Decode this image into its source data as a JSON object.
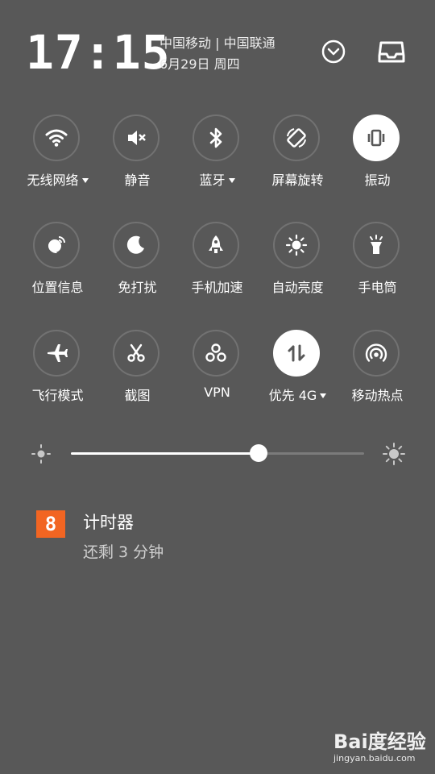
{
  "header": {
    "time": "17:15",
    "carrier": "中国移动 | 中国联通",
    "date": "6月29日 周四",
    "expand_icon": "chevron-down-circle-icon",
    "tray_icon": "notification-tray-icon"
  },
  "quick_settings": [
    {
      "label": "无线网络",
      "icon": "wifi-icon",
      "active": false,
      "dropdown": true
    },
    {
      "label": "静音",
      "icon": "mute-icon",
      "active": false,
      "dropdown": false
    },
    {
      "label": "蓝牙",
      "icon": "bluetooth-icon",
      "active": false,
      "dropdown": true
    },
    {
      "label": "屏幕旋转",
      "icon": "screen-rotate-icon",
      "active": false,
      "dropdown": false
    },
    {
      "label": "振动",
      "icon": "vibrate-icon",
      "active": true,
      "dropdown": false
    },
    {
      "label": "位置信息",
      "icon": "location-icon",
      "active": false,
      "dropdown": false
    },
    {
      "label": "免打扰",
      "icon": "moon-icon",
      "active": false,
      "dropdown": false
    },
    {
      "label": "手机加速",
      "icon": "rocket-icon",
      "active": false,
      "dropdown": false
    },
    {
      "label": "自动亮度",
      "icon": "auto-brightness-icon",
      "active": false,
      "dropdown": false
    },
    {
      "label": "手电筒",
      "icon": "flashlight-icon",
      "active": false,
      "dropdown": false
    },
    {
      "label": "飞行模式",
      "icon": "airplane-icon",
      "active": false,
      "dropdown": false
    },
    {
      "label": "截图",
      "icon": "scissors-icon",
      "active": false,
      "dropdown": false
    },
    {
      "label": "VPN",
      "icon": "vpn-icon",
      "active": false,
      "dropdown": false
    },
    {
      "label": "优先 4G",
      "icon": "data-transfer-icon",
      "active": true,
      "dropdown": true
    },
    {
      "label": "移动热点",
      "icon": "hotspot-icon",
      "active": false,
      "dropdown": false
    }
  ],
  "brightness": {
    "level": 0.64
  },
  "notification": {
    "app_icon_text": "8",
    "title": "计时器",
    "subtitle": "还剩 3 分钟"
  },
  "watermark": {
    "main": "Bai度经验",
    "url": "jingyan.baidu.com"
  },
  "colors": {
    "background": "#585858",
    "accent": "#f26522",
    "tile_border": "#727272"
  }
}
